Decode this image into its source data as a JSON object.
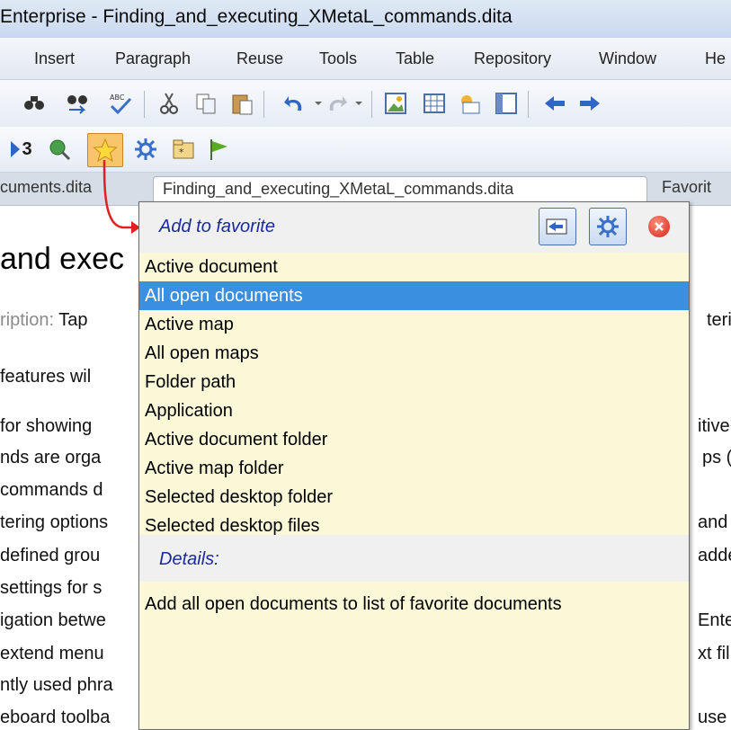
{
  "window": {
    "title": "Enterprise - Finding_and_executing_XMetaL_commands.dita"
  },
  "menu": [
    "Insert",
    "Paragraph",
    "Reuse",
    "Tools",
    "Table",
    "Repository",
    "Window",
    "He"
  ],
  "toolbar2": {
    "label": "3"
  },
  "tabs": {
    "first": "cuments.dita",
    "second": "Finding_and_executing_XMetaL_commands.dita",
    "third": "Favorit"
  },
  "document": {
    "heading": "and exec",
    "desc_label": "ription:",
    "desc_text": "Tap",
    "right_frag": "teri",
    "lines": [
      " features wil",
      " for showing",
      "nds are orga",
      "commands d",
      "tering options",
      " defined grou",
      "settings for s",
      "igation betwe",
      "extend menu",
      "ntly used phra",
      "eboard toolba"
    ],
    "right_lines": [
      "itive",
      "ps (",
      "and",
      "adde",
      "Enter",
      "xt fil",
      "use"
    ]
  },
  "popup": {
    "title": "Add to favorite",
    "items": [
      "Active document",
      "All open documents",
      "Active map",
      "All open maps",
      "Folder path",
      "Application",
      "Active document folder",
      "Active map folder",
      "Selected desktop folder",
      "Selected desktop files"
    ],
    "selected_index": 1,
    "details_label": "Details:",
    "details_text": "Add all open documents to list of favorite documents"
  },
  "colors": {
    "selection": "#3b8fe0",
    "popup_bg": "#fbf8d8",
    "header_text": "#1a2a9c",
    "arrow": "#e02020"
  }
}
